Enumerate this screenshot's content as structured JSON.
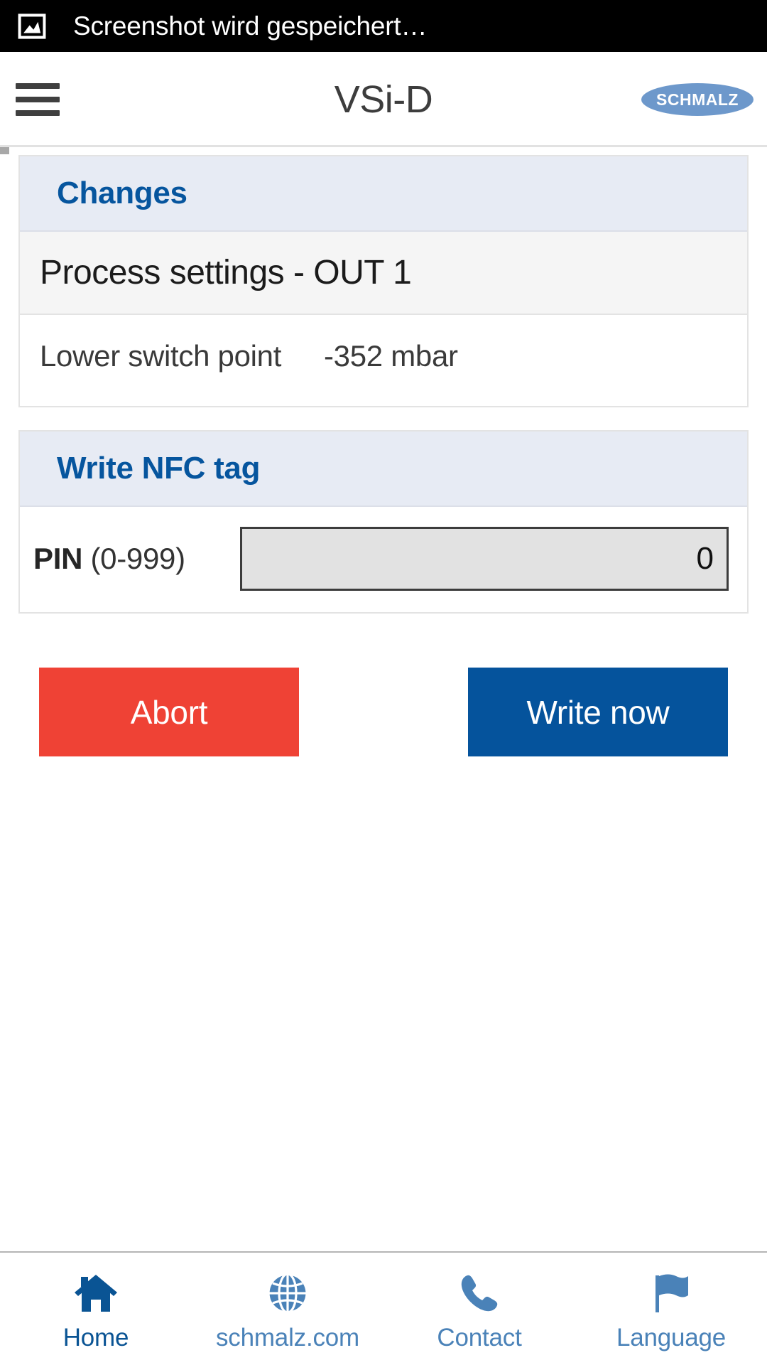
{
  "statusbar": {
    "icon": "image-saved-icon",
    "message": "Screenshot wird gespeichert…"
  },
  "header": {
    "menu_icon": "hamburger-menu-icon",
    "title": "VSi-D",
    "logo_text": "SCHMALZ",
    "logo_color": "#6d98cb"
  },
  "changes_card": {
    "title": "Changes",
    "subheading": "Process settings - OUT 1",
    "rows": [
      {
        "label": "Lower switch point",
        "value": "-352 mbar"
      }
    ]
  },
  "nfc_card": {
    "title": "Write NFC tag",
    "pin": {
      "label_bold": "PIN",
      "label_range": "(0-999)",
      "value": "0",
      "placeholder": "0"
    }
  },
  "actions": {
    "abort_label": "Abort",
    "abort_color": "#ef4235",
    "write_label": "Write now",
    "write_color": "#05539c"
  },
  "tabbar": {
    "items": [
      {
        "label": "Home",
        "icon": "home-icon",
        "active": true
      },
      {
        "label": "schmalz.com",
        "icon": "globe-icon",
        "active": false
      },
      {
        "label": "Contact",
        "icon": "phone-icon",
        "active": false
      },
      {
        "label": "Language",
        "icon": "flag-icon",
        "active": false
      }
    ]
  },
  "colors": {
    "brand_blue": "#05539c",
    "accent_red": "#ef4235",
    "card_header_bg": "#e7ebf4",
    "tab_inactive": "#4a82b8",
    "tab_active": "#0a5494"
  }
}
